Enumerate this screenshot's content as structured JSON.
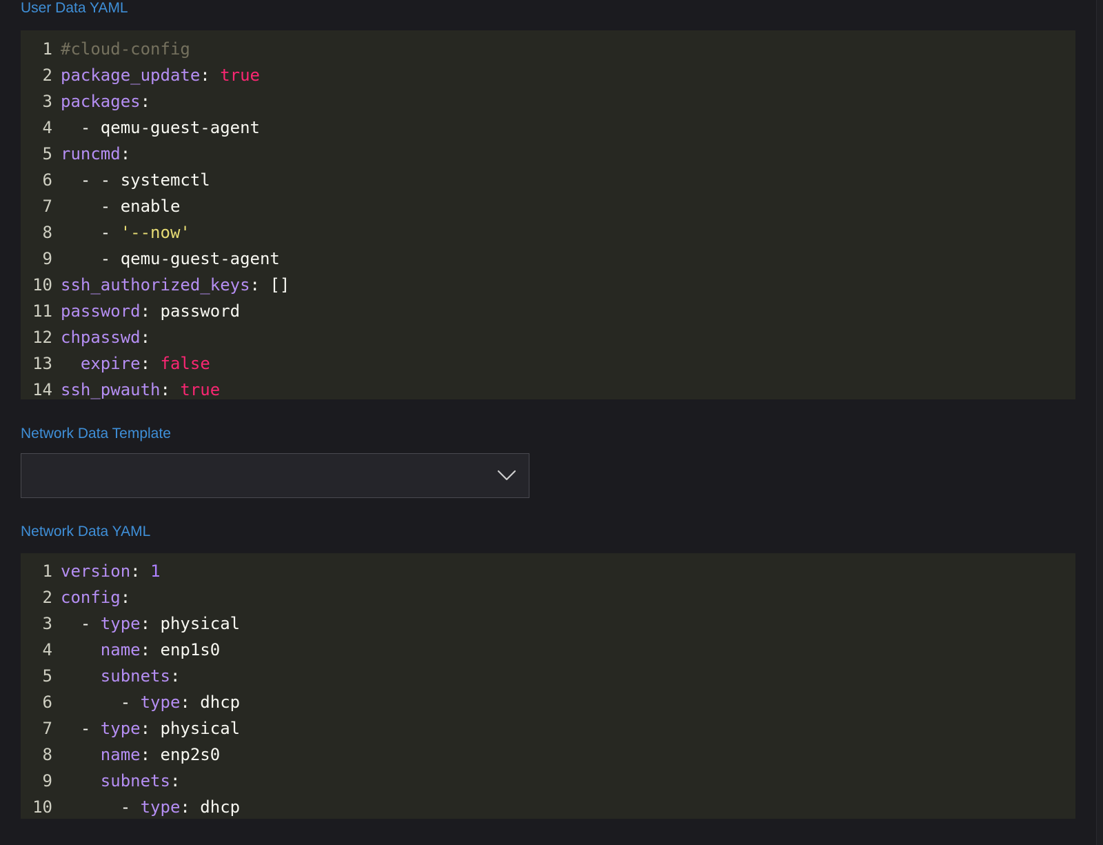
{
  "user_data": {
    "label": "User Data YAML",
    "lines": [
      [
        {
          "t": "#cloud-config",
          "c": "comment"
        }
      ],
      [
        {
          "t": "package_update",
          "c": "key"
        },
        {
          "t": ": ",
          "c": "text"
        },
        {
          "t": "true",
          "c": "bool"
        }
      ],
      [
        {
          "t": "packages",
          "c": "key"
        },
        {
          "t": ":",
          "c": "text"
        }
      ],
      [
        {
          "t": "  - qemu-guest-agent",
          "c": "text"
        }
      ],
      [
        {
          "t": "runcmd",
          "c": "key"
        },
        {
          "t": ":",
          "c": "text"
        }
      ],
      [
        {
          "t": "  - - systemctl",
          "c": "text"
        }
      ],
      [
        {
          "t": "    - enable",
          "c": "text"
        }
      ],
      [
        {
          "t": "    - ",
          "c": "text"
        },
        {
          "t": "'--now'",
          "c": "str"
        }
      ],
      [
        {
          "t": "    - qemu-guest-agent",
          "c": "text"
        }
      ],
      [
        {
          "t": "ssh_authorized_keys",
          "c": "key"
        },
        {
          "t": ": []",
          "c": "text"
        }
      ],
      [
        {
          "t": "password",
          "c": "key"
        },
        {
          "t": ": password",
          "c": "text"
        }
      ],
      [
        {
          "t": "chpasswd",
          "c": "key"
        },
        {
          "t": ":",
          "c": "text"
        }
      ],
      [
        {
          "t": "  ",
          "c": "text"
        },
        {
          "t": "expire",
          "c": "key"
        },
        {
          "t": ": ",
          "c": "text"
        },
        {
          "t": "false",
          "c": "bool"
        }
      ],
      [
        {
          "t": "ssh_pwauth",
          "c": "key"
        },
        {
          "t": ": ",
          "c": "text"
        },
        {
          "t": "true",
          "c": "bool"
        }
      ]
    ]
  },
  "network_template": {
    "label": "Network Data Template",
    "selected_value": "",
    "icon": "chevron-down-icon"
  },
  "network_data": {
    "label": "Network Data YAML",
    "lines": [
      [
        {
          "t": "version",
          "c": "key"
        },
        {
          "t": ": ",
          "c": "text"
        },
        {
          "t": "1",
          "c": "num"
        }
      ],
      [
        {
          "t": "config",
          "c": "key"
        },
        {
          "t": ":",
          "c": "text"
        }
      ],
      [
        {
          "t": "  - ",
          "c": "text"
        },
        {
          "t": "type",
          "c": "key"
        },
        {
          "t": ": physical",
          "c": "text"
        }
      ],
      [
        {
          "t": "    ",
          "c": "text"
        },
        {
          "t": "name",
          "c": "key"
        },
        {
          "t": ": enp1s0",
          "c": "text"
        }
      ],
      [
        {
          "t": "    ",
          "c": "text"
        },
        {
          "t": "subnets",
          "c": "key"
        },
        {
          "t": ":",
          "c": "text"
        }
      ],
      [
        {
          "t": "      - ",
          "c": "text"
        },
        {
          "t": "type",
          "c": "key"
        },
        {
          "t": ": dhcp",
          "c": "text"
        }
      ],
      [
        {
          "t": "  - ",
          "c": "text"
        },
        {
          "t": "type",
          "c": "key"
        },
        {
          "t": ": physical",
          "c": "text"
        }
      ],
      [
        {
          "t": "    ",
          "c": "text"
        },
        {
          "t": "name",
          "c": "key"
        },
        {
          "t": ": enp2s0",
          "c": "text"
        }
      ],
      [
        {
          "t": "    ",
          "c": "text"
        },
        {
          "t": "subnets",
          "c": "key"
        },
        {
          "t": ":",
          "c": "text"
        }
      ],
      [
        {
          "t": "      - ",
          "c": "text"
        },
        {
          "t": "type",
          "c": "key"
        },
        {
          "t": ": dhcp",
          "c": "text"
        }
      ]
    ]
  }
}
